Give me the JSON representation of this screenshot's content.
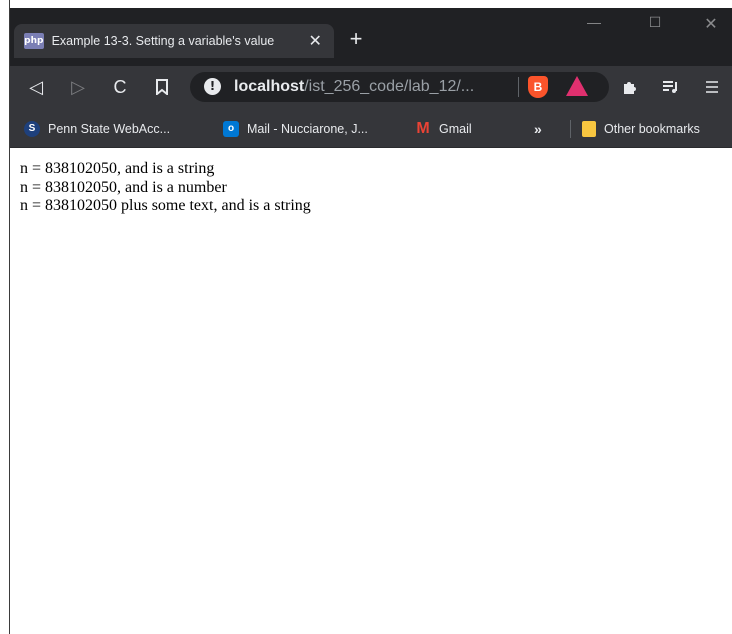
{
  "tab": {
    "favicon_text": "php",
    "title": "Example 13-3. Setting a variable's value",
    "close": "✕",
    "new_tab": "+"
  },
  "window_controls": {
    "minimize": "—",
    "maximize": "☐",
    "close": "✕"
  },
  "toolbar": {
    "back": "◁",
    "forward": "▷",
    "reload": "C",
    "bookmark": "🔖",
    "url_host": "localhost",
    "url_path": "/ist_256_code/lab_12/...",
    "info": "!",
    "brave": "B"
  },
  "bookmarks": {
    "items": [
      {
        "label": "Penn State WebAcc..."
      },
      {
        "label": "Mail - Nucciarone, J..."
      },
      {
        "label": "Gmail"
      }
    ],
    "more": "»",
    "other": "Other bookmarks",
    "psu_icon": "S",
    "mail_icon": "o",
    "gmail_icon": "M"
  },
  "content": {
    "lines": [
      "n = 838102050, and is a string",
      "n = 838102050, and is a number",
      "n = 838102050 plus some text, and is a string"
    ]
  },
  "colors": {
    "titlebar": "#202124",
    "toolbar": "#35363a",
    "brave": "#fb542b",
    "bat": "#e0306f"
  }
}
